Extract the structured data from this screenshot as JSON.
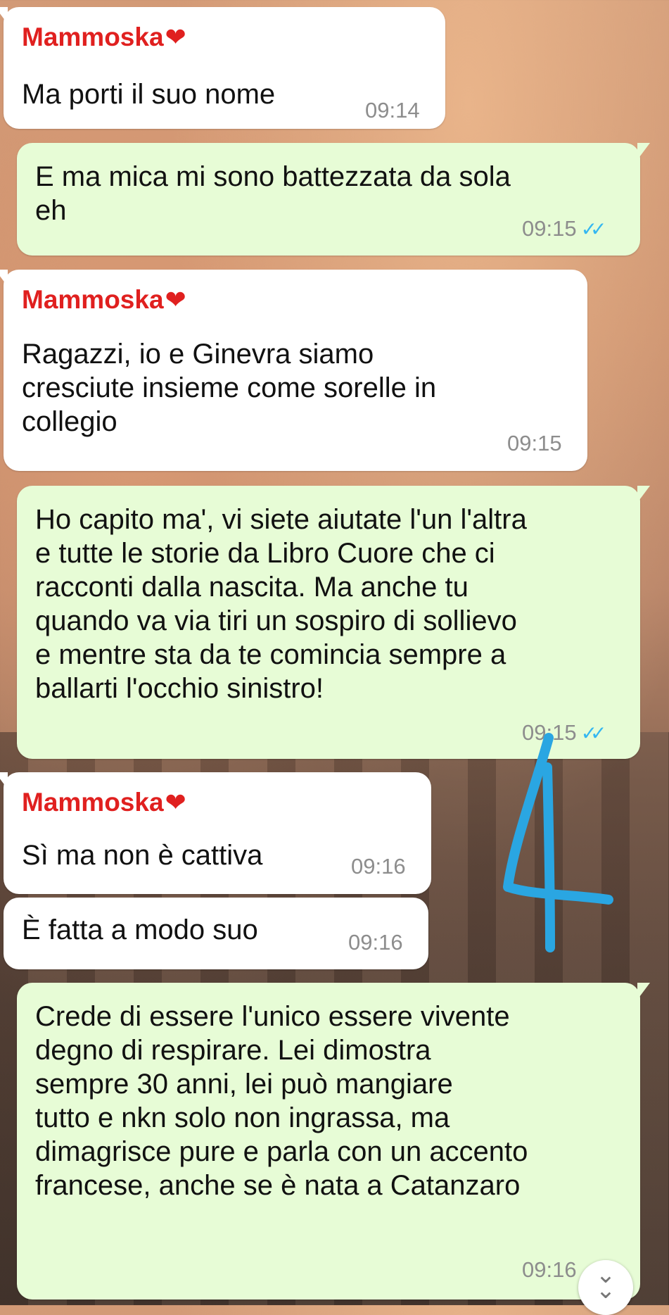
{
  "messages": [
    {
      "sender": "Mammoska",
      "heart": "❤",
      "text": "Ma porti il suo nome",
      "time": "09:14"
    },
    {
      "text": "E ma mica mi sono battezzata da sola\neh",
      "time": "09:15",
      "status": "read"
    },
    {
      "sender": "Mammoska",
      "heart": "❤",
      "text": "Ragazzi, io e Ginevra siamo\ncresciute insieme come sorelle in\ncollegio",
      "time": "09:15"
    },
    {
      "text": "Ho capito ma', vi siete aiutate l'un l'altra\ne tutte le storie da Libro Cuore che ci\nracconti dalla nascita. Ma anche tu\nquando va via tiri un sospiro di sollievo\ne mentre sta da te comincia sempre a\nballarti l'occhio sinistro!",
      "time": "09:15",
      "status": "read"
    },
    {
      "sender": "Mammoska",
      "heart": "❤",
      "text": "Sì ma non è cattiva",
      "time": "09:16"
    },
    {
      "text": "È fatta a modo suo",
      "time": "09:16"
    },
    {
      "text": "Crede di essere l'unico essere vivente\ndegno di respirare. Lei dimostra\nsempre 30 anni, lei può mangiare\ntutto e nkn solo non ingrassa, ma\ndimagrisce pure e parla con un accento\nfrancese, anche se è nata a Catanzaro",
      "time": "09:16",
      "status": "read"
    }
  ],
  "read_ticks": "✓✓",
  "scroll_down_icon": "double-chevron-down-icon",
  "colors": {
    "sender": "#e0201f",
    "incoming": "#ffffff",
    "outgoing": "#e7fcd6",
    "read_ticks": "#34b7f1",
    "annotation": "#2aa6e2"
  }
}
